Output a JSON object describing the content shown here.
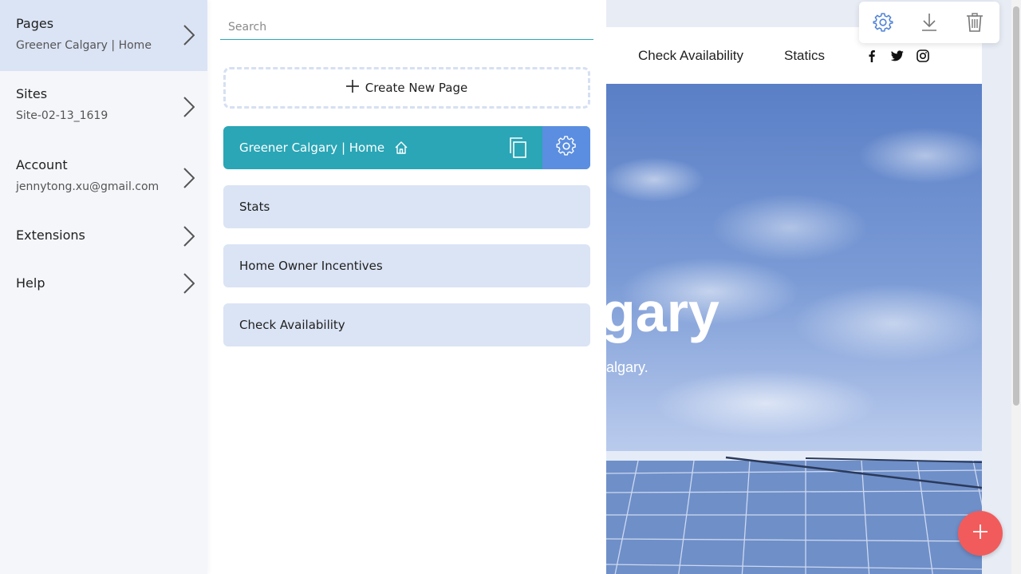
{
  "nav": {
    "items": [
      {
        "title": "Pages",
        "subtitle": "Greener Calgary | Home"
      },
      {
        "title": "Sites",
        "subtitle": "Site-02-13_1619"
      },
      {
        "title": "Account",
        "subtitle": "jennytong.xu@gmail.com"
      },
      {
        "title": "Extensions"
      },
      {
        "title": "Help"
      }
    ]
  },
  "pages_panel": {
    "search_placeholder": "Search",
    "create_label": "Create New Page",
    "pages": [
      {
        "title": "Greener Calgary | Home",
        "active": true,
        "is_home": true
      },
      {
        "title": "Stats"
      },
      {
        "title": "Home Owner Incentives"
      },
      {
        "title": "Check Availability"
      }
    ]
  },
  "preview": {
    "nav_links": [
      "Check Availability",
      "Statics"
    ],
    "social_icons": [
      "facebook-icon",
      "twitter-icon",
      "instagram-icon"
    ],
    "hero_title_fragment": "gary",
    "hero_subtitle_fragment": "algary.",
    "toolbar_icons": [
      "gear-icon",
      "download-icon",
      "trash-icon"
    ]
  },
  "colors": {
    "accent_teal": "#2aa6b6",
    "accent_blue": "#5b8ee0",
    "active_row": "#dbe4f5",
    "fab_red": "#f25b5b"
  }
}
